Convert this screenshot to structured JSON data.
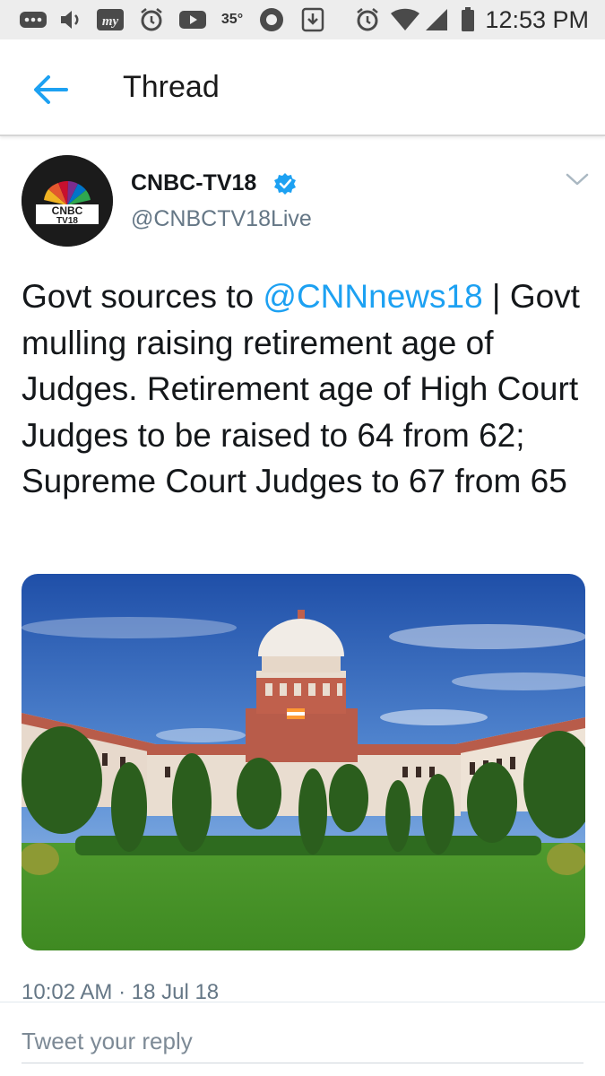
{
  "status_bar": {
    "time": "12:53 PM",
    "temperature": "35°",
    "icons": [
      "more-icon",
      "volume-icon",
      "mytoday-icon",
      "alarm-icon",
      "youtube-icon",
      "temperature-text",
      "opera-icon",
      "download-icon",
      "alarm-icon",
      "wifi-icon",
      "signal-icon",
      "battery-icon"
    ],
    "app_label": "my"
  },
  "app_bar": {
    "back_icon": "arrow-left-icon",
    "title": "Thread"
  },
  "tweet": {
    "avatar_label_line1": "CNBC",
    "avatar_label_line2": "TV18",
    "user_name": "CNBC-TV18",
    "user_handle": "@CNBCTV18Live",
    "verified_icon": "verified-badge-icon",
    "caret_icon": "chevron-down-icon",
    "text_prefix": "Govt sources to ",
    "mention": "@CNNnews18",
    "text_suffix": " | Govt mulling raising retirement age of Judges. Retirement age of High Court Judges to be raised to 64 from 62; Supreme Court Judges to 67 from 65",
    "media_description_icon": "photo-supreme-court",
    "timestamp": "10:02 AM · 18 Jul 18"
  },
  "reply": {
    "placeholder": "Tweet your reply"
  },
  "colors": {
    "accent": "#1da1f2",
    "secondary_text": "#657786",
    "status_bar_bg": "#ededed"
  }
}
